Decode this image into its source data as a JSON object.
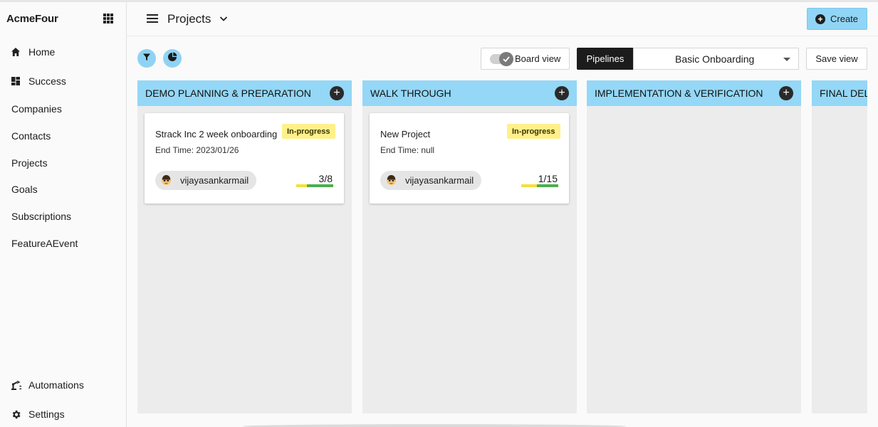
{
  "app": {
    "brand": "AcmeFour"
  },
  "sidebar": {
    "top_items": [
      {
        "label": "Home",
        "icon": "home-icon"
      },
      {
        "label": "Success",
        "icon": "dashboard-icon"
      }
    ],
    "plain_items": [
      "Companies",
      "Contacts",
      "Projects",
      "Goals",
      "Subscriptions",
      "FeatureAEvent"
    ],
    "bottom_items": [
      {
        "label": "Automations",
        "icon": "robot-arm-icon"
      },
      {
        "label": "Settings",
        "icon": "gear-icon"
      }
    ]
  },
  "header": {
    "title": "Projects",
    "create_label": "Create"
  },
  "toolbar": {
    "board_view_label": "Board view",
    "board_view_on": true,
    "pipelines_label": "Pipelines",
    "pipeline_selected": "Basic Onboarding",
    "save_view_label": "Save view"
  },
  "columns": [
    {
      "title": "DEMO PLANNING & PREPARATION",
      "cards": [
        {
          "title": "Strack Inc 2 week onboarding",
          "end_time": "End Time: 2023/01/26",
          "status": "In-progress",
          "assignee": "vijayasankarmail",
          "progress_text": "3/8",
          "done": 3,
          "total": 8
        }
      ]
    },
    {
      "title": "WALK THROUGH",
      "cards": [
        {
          "title": "New Project",
          "end_time": "End Time: null",
          "status": "In-progress",
          "assignee": "vijayasankarmail",
          "progress_text": "1/15",
          "done": 1,
          "total": 15
        }
      ]
    },
    {
      "title": "IMPLEMENTATION & VERIFICATION",
      "cards": []
    },
    {
      "title": "FINAL DELIVERY",
      "cards": []
    }
  ],
  "colors": {
    "accent": "#94d7f6",
    "status_badge": "#fff08a",
    "progress_done": "#4cae4f",
    "progress_pending": "#f2e13c"
  }
}
